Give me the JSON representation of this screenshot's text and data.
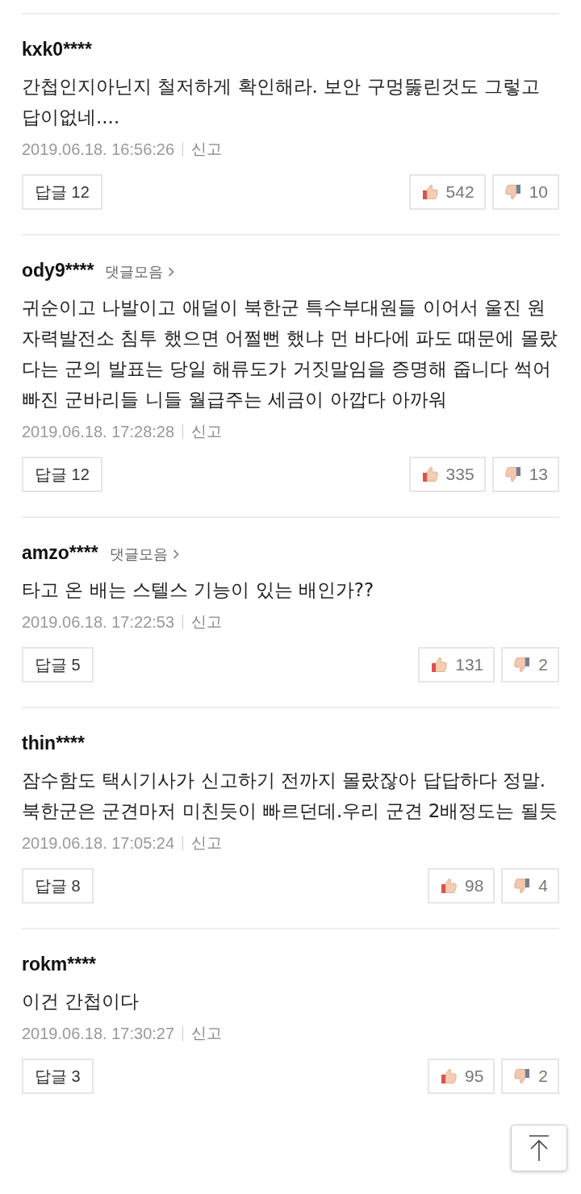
{
  "comments": [
    {
      "user": "kxk0****",
      "body": "간첩인지아닌지 철저하게 확인해라. 보안 구멍뚫린것도 그렇고 답이없네....",
      "date": "2019.06.18. 16:56:26",
      "report": "신고",
      "reply_label": "답글",
      "reply_count": "12",
      "likes": "542",
      "dislikes": "10"
    },
    {
      "user": "ody9****",
      "collection_link": "댓글모음",
      "body": "귀순이고 나발이고 애덜이 북한군 특수부대원들 이어서 울진 원자력발전소 침투 했으면 어쩔뻔 했냐 먼 바다에 파도 때문에 몰랐다는 군의 발표는 당일 해류도가 거짓말임을 증명해 줍니다 썩어빠진 군바리들 니들 월급주는 세금이 아깝다 아까워",
      "date": "2019.06.18. 17:28:28",
      "report": "신고",
      "reply_label": "답글",
      "reply_count": "12",
      "likes": "335",
      "dislikes": "13"
    },
    {
      "user": "amzo****",
      "collection_link": "댓글모음",
      "body": "타고 온 배는 스텔스 기능이 있는 배인가??",
      "date": "2019.06.18. 17:22:53",
      "report": "신고",
      "reply_label": "답글",
      "reply_count": "5",
      "likes": "131",
      "dislikes": "2"
    },
    {
      "user": "thin****",
      "body": "잠수함도 택시기사가 신고하기 전까지 몰랐잖아 답답하다 정말.북한군은 군견마저 미친듯이 빠르던데.우리 군견 2배정도는 될듯",
      "date": "2019.06.18. 17:05:24",
      "report": "신고",
      "reply_label": "답글",
      "reply_count": "8",
      "likes": "98",
      "dislikes": "4"
    },
    {
      "user": "rokm****",
      "body": "이건 간첩이다",
      "date": "2019.06.18. 17:30:27",
      "report": "신고",
      "reply_label": "답글",
      "reply_count": "3",
      "likes": "95",
      "dislikes": "2"
    }
  ]
}
